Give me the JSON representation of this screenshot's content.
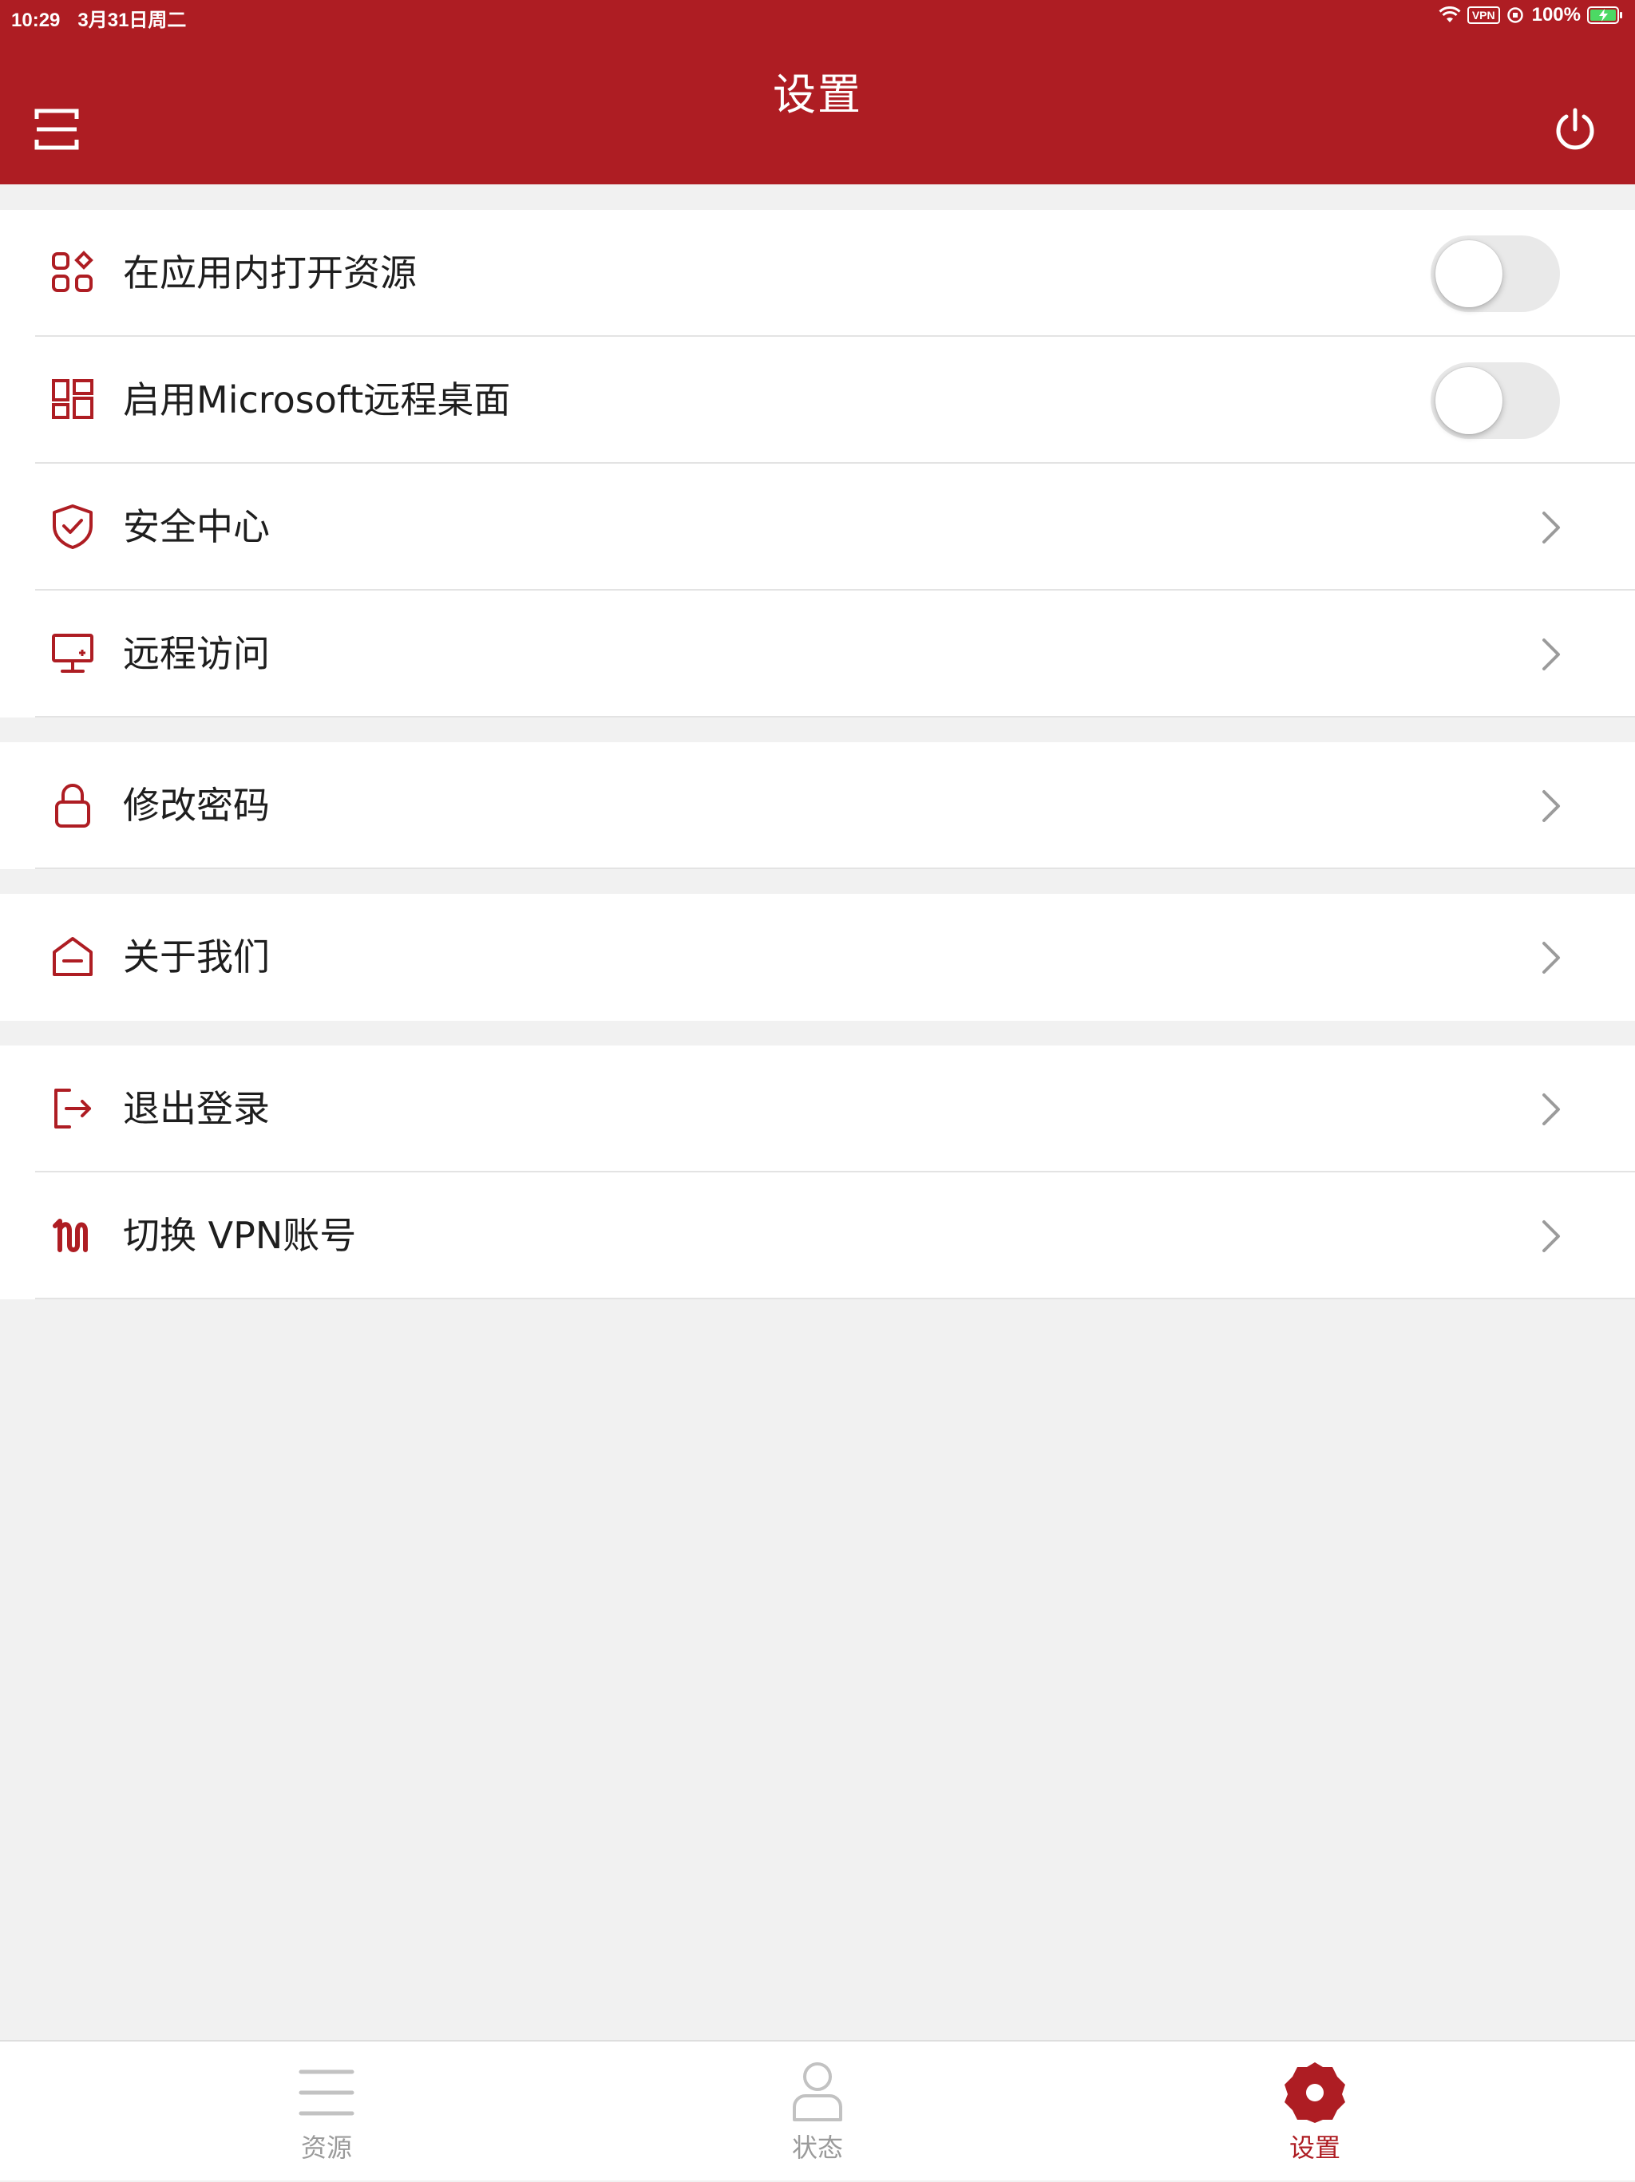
{
  "status_bar": {
    "time": "10:29",
    "date": "3月31日周二",
    "vpn": "VPN",
    "battery": "100%"
  },
  "header": {
    "title": "设置",
    "menu_icon": "scan-menu-icon",
    "power_icon": "power-icon"
  },
  "colors": {
    "brand": "#ae1d23",
    "background": "#f1f1f1"
  },
  "settings": {
    "group1": [
      {
        "label": "在应用内打开资源",
        "icon": "grid-apps-icon",
        "type": "toggle",
        "on": false
      },
      {
        "label": "启用Microsoft远程桌面",
        "icon": "windows-icon",
        "type": "toggle",
        "on": false
      },
      {
        "label": "安全中心",
        "icon": "shield-check-icon",
        "type": "link"
      },
      {
        "label": "远程访问",
        "icon": "monitor-icon",
        "type": "link"
      }
    ],
    "group2": [
      {
        "label": "修改密码",
        "icon": "lock-icon",
        "type": "link"
      }
    ],
    "group3": [
      {
        "label": "关于我们",
        "icon": "home-icon",
        "type": "link"
      }
    ],
    "group4": [
      {
        "label": "退出登录",
        "icon": "logout-icon",
        "type": "link"
      },
      {
        "label": "切换 VPN账号",
        "icon": "switch-account-icon",
        "type": "link"
      }
    ]
  },
  "tabs": [
    {
      "label": "资源",
      "icon": "list-icon",
      "active": false
    },
    {
      "label": "状态",
      "icon": "user-icon",
      "active": false
    },
    {
      "label": "设置",
      "icon": "settings-gear-icon",
      "active": true
    }
  ]
}
